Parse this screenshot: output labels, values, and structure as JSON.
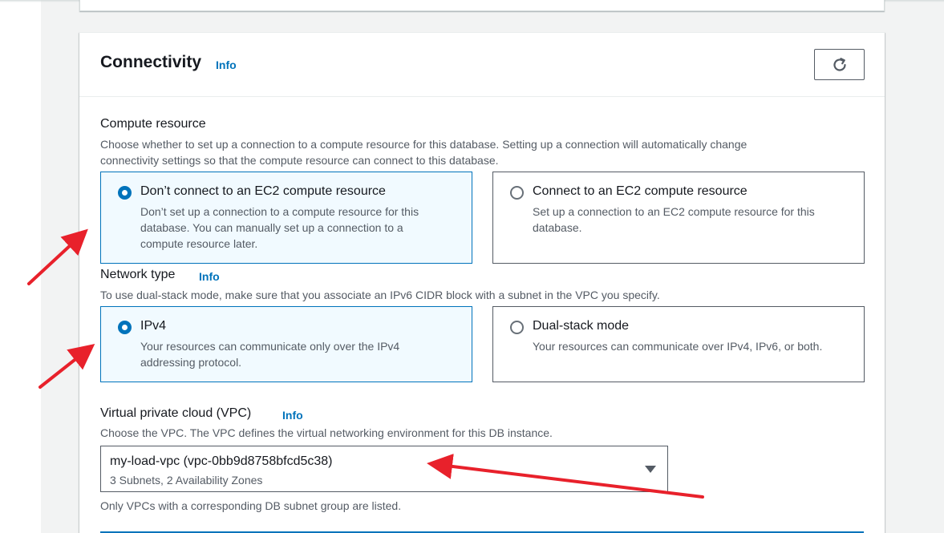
{
  "section": {
    "title": "Connectivity",
    "info_label": "Info",
    "refresh_icon": "refresh-icon"
  },
  "compute_resource": {
    "label": "Compute resource",
    "description_line1": "Choose whether to set up a connection to a compute resource for this database. Setting up a connection will automatically change",
    "description_line2": "connectivity settings so that the compute resource can connect to this database.",
    "options": [
      {
        "title": "Don’t connect to an EC2 compute resource",
        "desc_line1": "Don’t set up a connection to a compute resource for this",
        "desc_line2": "database. You can manually set up a connection to a",
        "desc_line3": "compute resource later.",
        "selected": true
      },
      {
        "title": "Connect to an EC2 compute resource",
        "desc_line1": "Set up a connection to an EC2 compute resource for this",
        "desc_line2": "database.",
        "selected": false
      }
    ]
  },
  "network_type": {
    "label": "Network type",
    "info_label": "Info",
    "description": "To use dual-stack mode, make sure that you associate an IPv6 CIDR block with a subnet in the VPC you specify.",
    "options": [
      {
        "title": "IPv4",
        "desc_line1": "Your resources can communicate only over the IPv4",
        "desc_line2": "addressing protocol.",
        "selected": true
      },
      {
        "title": "Dual-stack mode",
        "desc_line1": "Your resources can communicate over IPv4, IPv6, or both.",
        "selected": false
      }
    ]
  },
  "vpc": {
    "label": "Virtual private cloud (VPC)",
    "info_label": "Info",
    "description": "Choose the VPC. The VPC defines the virtual networking environment for this DB instance.",
    "selected_value": "my-load-vpc (vpc-0bb9d8758bfcd5c38)",
    "selected_detail": "3 Subnets, 2 Availability Zones",
    "footnote": "Only VPCs with a corresponding DB subnet group are listed."
  },
  "colors": {
    "accent": "#0073bb",
    "annotation_arrow": "#e8212b",
    "selected_tile_bg": "#f1faff"
  }
}
